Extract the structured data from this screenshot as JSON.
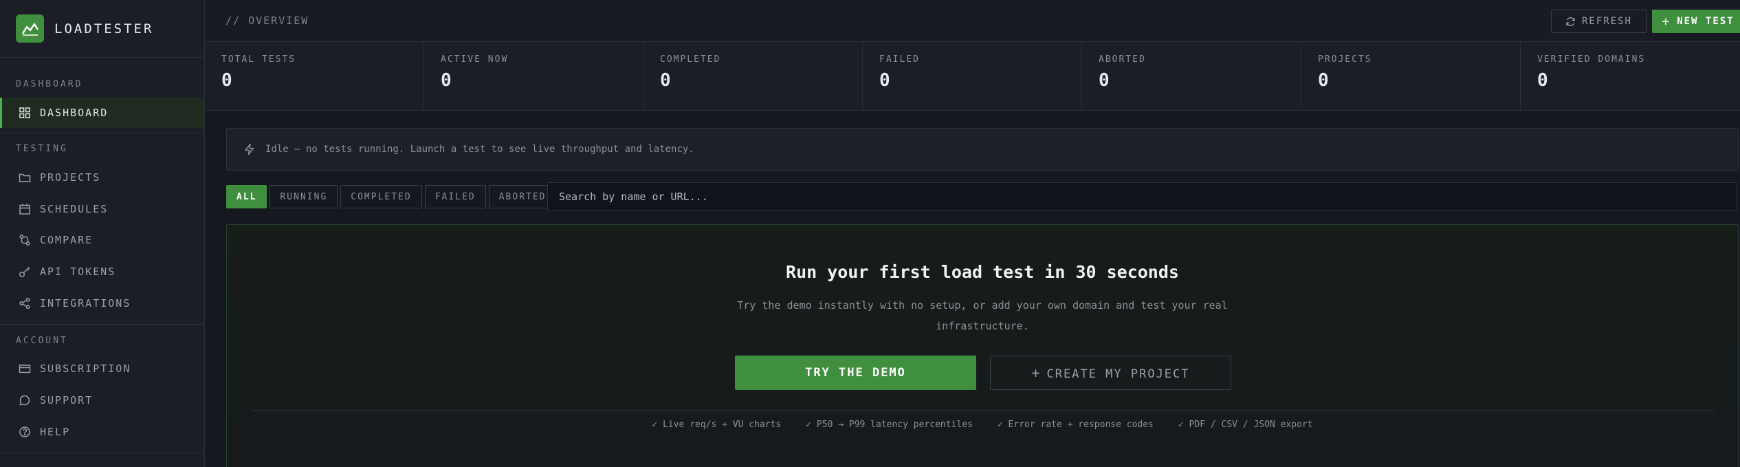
{
  "brand": {
    "name": "LOADTESTER",
    "logo_icon": "chart-line-icon",
    "accent": "#3f8f3e"
  },
  "sidebar": {
    "sections": {
      "dashboard": "DASHBOARD",
      "testing": "TESTING",
      "account": "ACCOUNT"
    },
    "items": [
      {
        "label": "DASHBOARD",
        "icon": "grid-icon",
        "active": true
      },
      {
        "label": "PROJECTS",
        "icon": "folder-icon"
      },
      {
        "label": "SCHEDULES",
        "icon": "calendar-icon"
      },
      {
        "label": "COMPARE",
        "icon": "compare-icon"
      },
      {
        "label": "API TOKENS",
        "icon": "key-icon"
      },
      {
        "label": "INTEGRATIONS",
        "icon": "share-icon"
      },
      {
        "label": "SUBSCRIPTION",
        "icon": "credit-card-icon"
      },
      {
        "label": "SUPPORT",
        "icon": "chat-icon"
      },
      {
        "label": "HELP",
        "icon": "help-icon"
      }
    ]
  },
  "topbar": {
    "breadcrumb": "// OVERVIEW",
    "refresh_label": "REFRESH",
    "new_test_label": "NEW TEST"
  },
  "stats": [
    {
      "label": "TOTAL TESTS",
      "value": "0"
    },
    {
      "label": "ACTIVE NOW",
      "value": "0"
    },
    {
      "label": "COMPLETED",
      "value": "0"
    },
    {
      "label": "FAILED",
      "value": "0"
    },
    {
      "label": "ABORTED",
      "value": "0"
    },
    {
      "label": "PROJECTS",
      "value": "0"
    },
    {
      "label": "VERIFIED DOMAINS",
      "value": "0"
    }
  ],
  "idle_banner": {
    "text": "Idle — no tests running. Launch a test to see live throughput and latency."
  },
  "filters": [
    {
      "label": "ALL",
      "active": true
    },
    {
      "label": "RUNNING"
    },
    {
      "label": "COMPLETED"
    },
    {
      "label": "FAILED"
    },
    {
      "label": "ABORTED"
    }
  ],
  "search": {
    "placeholder": "Search by name or URL..."
  },
  "empty_state": {
    "title": "Run your first load test in 30 seconds",
    "description": "Try the demo instantly with no setup, or add your own domain and test your real infrastructure.",
    "demo_label": "TRY THE DEMO",
    "create_label": "CREATE MY PROJECT",
    "features": [
      "✓ Live req/s + VU charts",
      "✓ P50 → P99 latency percentiles",
      "✓ Error rate + response codes",
      "✓ PDF / CSV / JSON export"
    ]
  }
}
